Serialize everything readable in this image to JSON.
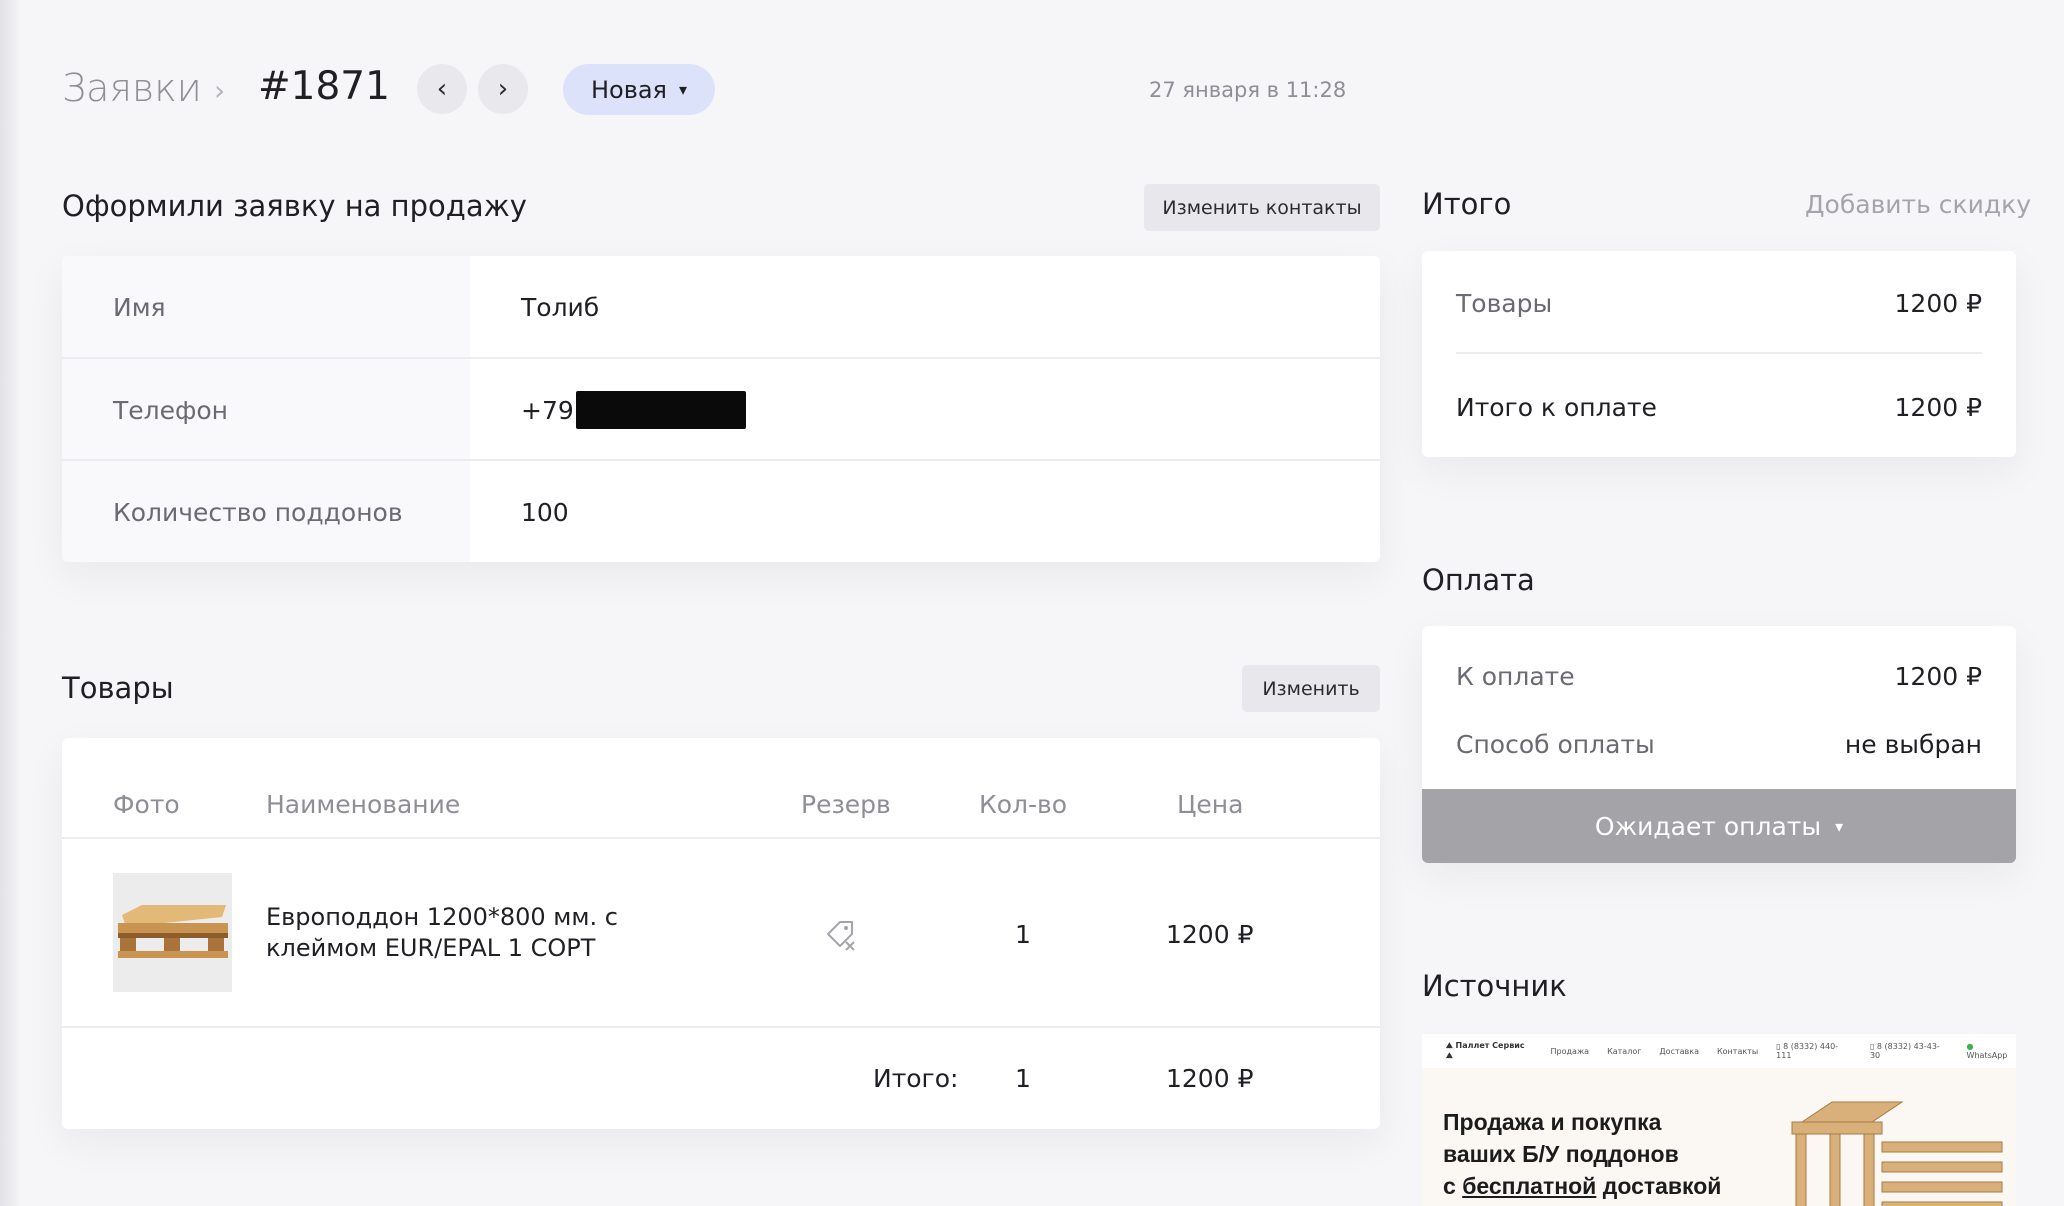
{
  "header": {
    "breadcrumb": "Заявки",
    "order_number": "#1871",
    "status": "Новая",
    "date": "27 января в 11:28"
  },
  "contacts": {
    "title": "Оформили заявку на продажу",
    "edit_label": "Изменить контакты",
    "rows": [
      {
        "label": "Имя",
        "value": "Толиб"
      },
      {
        "label": "Телефон",
        "value": "+79"
      },
      {
        "label": "Количество поддонов",
        "value": "100"
      }
    ]
  },
  "goods": {
    "title": "Товары",
    "edit_label": "Изменить",
    "columns": {
      "photo": "Фото",
      "name": "Наименование",
      "reserve": "Резерв",
      "qty": "Кол-во",
      "price": "Цена"
    },
    "items": [
      {
        "name": "Европоддон 1200*800 мм. с клеймом EUR/EPAL 1 СОРТ",
        "qty": "1",
        "price": "1200 ₽"
      }
    ],
    "total_label": "Итого:",
    "total_qty": "1",
    "total_price": "1200 ₽"
  },
  "summary": {
    "title": "Итого",
    "discount_label": "Добавить скидку",
    "goods_label": "Товары",
    "goods_value": "1200 ₽",
    "total_label": "Итого к оплате",
    "total_value": "1200 ₽"
  },
  "payment": {
    "title": "Оплата",
    "due_label": "К оплате",
    "due_value": "1200 ₽",
    "method_label": "Способ оплаты",
    "method_value": "не выбран",
    "status_button": "Ожидает оплаты"
  },
  "source": {
    "title": "Источник",
    "nav": {
      "logo": "Паллет Сервис",
      "items": [
        "Продажа",
        "Каталог",
        "Доставка",
        "Контакты"
      ],
      "phone1": "8 (8332) 440-111",
      "phone2": "8 (8332) 43-43-30",
      "whatsapp": "WhatsApp"
    },
    "headline": {
      "line1": "Продажа и покупка",
      "line2": "ваших Б/У поддонов",
      "line3_pre": "с ",
      "line3_underlined": "бесплатной",
      "line3_post": " доставкой"
    }
  },
  "colors": {
    "status_pill": "#dde2fb",
    "awaiting_button": "#a3a3a8",
    "background": "#f6f6f8"
  }
}
